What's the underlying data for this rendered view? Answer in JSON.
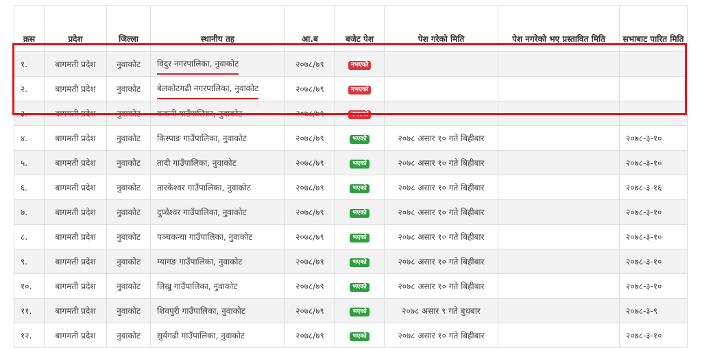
{
  "table": {
    "headers": {
      "sn": "क्रस",
      "province": "प्रदेश",
      "district": "जिल्ला",
      "local": "स्थानीय तह",
      "fy": "आ.ब",
      "budget": "बजेट पेश",
      "submitted_date": "पेश गरेको मिति",
      "proposed_date": "पेश नगरेको भए प्रस्तावित मिति",
      "passed_date": "सभाबाट पारित मिति"
    },
    "rows": [
      {
        "sn": "१.",
        "province": "बागमती प्रदेश",
        "district": "नुवाकोट",
        "local": "विदुर नगरपालिका, नुवाकोट",
        "fy": "२०७८/७९",
        "budget": "नभएको",
        "submitted": "",
        "proposed": "",
        "passed": ""
      },
      {
        "sn": "२.",
        "province": "बागमती प्रदेश",
        "district": "नुवाकोट",
        "local": "बेलकोटगढी नगरपालिका, नुवाकोट",
        "fy": "२०७८/७९",
        "budget": "नभएको",
        "submitted": "",
        "proposed": "",
        "passed": ""
      },
      {
        "sn": "३.",
        "province": "बागमती प्रदेश",
        "district": "नुवाकोट",
        "local": "ककनी गाउँपालिका, नुवाकोट",
        "fy": "२०७८/७९",
        "budget": "नभएको",
        "submitted": "",
        "proposed": "",
        "passed": ""
      },
      {
        "sn": "४.",
        "province": "बागमती प्रदेश",
        "district": "नुवाकोट",
        "local": "किस्पाङ गाउँपालिका, नुवाकोट",
        "fy": "२०७८/७९",
        "budget": "भएको",
        "submitted": "२०७८ असार १० गते बिहीबार",
        "proposed": "",
        "passed": "२०७८-३-१०"
      },
      {
        "sn": "५.",
        "province": "बागमती प्रदेश",
        "district": "नुवाकोट",
        "local": "तादी गाउँपालिका, नुवाकोट",
        "fy": "२०७८/७९",
        "budget": "भएको",
        "submitted": "२०७८ असार १० गते बिहीबार",
        "proposed": "",
        "passed": "२०७८-३-१०"
      },
      {
        "sn": "६.",
        "province": "बागमती प्रदेश",
        "district": "नुवाकोट",
        "local": "तारकेश्वर गाउँपालिका, नुवाकोट",
        "fy": "२०७८/७९",
        "budget": "भएको",
        "submitted": "२०७८ असार १० गते बिहीबार",
        "proposed": "",
        "passed": "२०७८-३-१६"
      },
      {
        "sn": "७.",
        "province": "बागमती प्रदेश",
        "district": "नुवाकोट",
        "local": "दुप्चेश्वर गाउँपालिका, नुवाकोट",
        "fy": "२०७८/७९",
        "budget": "भएको",
        "submitted": "२०७८ असार १० गते बिहीबार",
        "proposed": "",
        "passed": "२०७८-३-१०"
      },
      {
        "sn": "८.",
        "province": "बागमती प्रदेश",
        "district": "नुवाकोट",
        "local": "पञ्चकन्या गाउँपालिका, नुवाकोट",
        "fy": "२०७८/७९",
        "budget": "भएको",
        "submitted": "२०७८ असार १० गते बिहीबार",
        "proposed": "",
        "passed": "२०७८-३-१०"
      },
      {
        "sn": "९.",
        "province": "बागमती प्रदेश",
        "district": "नुवाकोट",
        "local": "म्यागङ गाउँपालिका, नुवाकोट",
        "fy": "२०७८/७९",
        "budget": "भएको",
        "submitted": "२०७८ असार १० गते बिहीबार",
        "proposed": "",
        "passed": "२०७८-३-१०"
      },
      {
        "sn": "१०.",
        "province": "बागमती प्रदेश",
        "district": "नुवाकोट",
        "local": "लिखु गाउँपालिका, नुवाकोट",
        "fy": "२०७८/७९",
        "budget": "भएको",
        "submitted": "२०७८ असार १० गते बिहीबार",
        "proposed": "",
        "passed": "२०७८-३-१०"
      },
      {
        "sn": "११.",
        "province": "बागमती प्रदेश",
        "district": "नुवाकोट",
        "local": "शिवपुरी गाउँपालिका, नुवाकोट",
        "fy": "२०७८/७९",
        "budget": "भएको",
        "submitted": "२०७८ असार ९ गते बुधबार",
        "proposed": "",
        "passed": "२०७८-३-९"
      },
      {
        "sn": "१२.",
        "province": "बागमती प्रदेश",
        "district": "नुवाकोट",
        "local": "सुर्यगढी गाउँपालिका, नुवाकोट",
        "fy": "२०७८/७९",
        "budget": "भएको",
        "submitted": "२०७८ असार १० गते बिहीबार",
        "proposed": "",
        "passed": "२०७८-३-१०"
      }
    ]
  },
  "colors": {
    "highlight_border": "#e8141c",
    "badge_no": "#d9363e",
    "badge_yes": "#2e9e3e"
  }
}
